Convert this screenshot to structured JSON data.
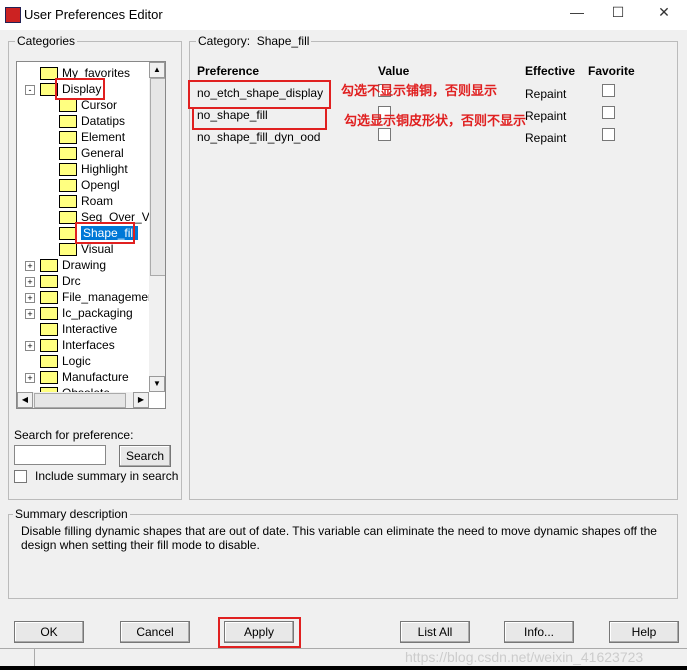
{
  "window": {
    "title": "User Preferences Editor",
    "min": "—",
    "max": "☐",
    "close": "✕"
  },
  "categories": {
    "label": "Categories",
    "items": [
      {
        "label": "My_favorites",
        "level": 0,
        "expander": ""
      },
      {
        "label": "Display",
        "level": 0,
        "expander": "-"
      },
      {
        "label": "Cursor",
        "level": 1,
        "expander": ""
      },
      {
        "label": "Datatips",
        "level": 1,
        "expander": ""
      },
      {
        "label": "Element",
        "level": 1,
        "expander": ""
      },
      {
        "label": "General",
        "level": 1,
        "expander": ""
      },
      {
        "label": "Highlight",
        "level": 1,
        "expander": ""
      },
      {
        "label": "Opengl",
        "level": 1,
        "expander": ""
      },
      {
        "label": "Roam",
        "level": 1,
        "expander": ""
      },
      {
        "label": "Seg_Over_Voi",
        "level": 1,
        "expander": ""
      },
      {
        "label": "Shape_fill",
        "level": 1,
        "expander": "",
        "selected": true
      },
      {
        "label": "Visual",
        "level": 1,
        "expander": ""
      },
      {
        "label": "Drawing",
        "level": 0,
        "expander": "+"
      },
      {
        "label": "Drc",
        "level": 0,
        "expander": "+"
      },
      {
        "label": "File_management",
        "level": 0,
        "expander": "+"
      },
      {
        "label": "Ic_packaging",
        "level": 0,
        "expander": "+"
      },
      {
        "label": "Interactive",
        "level": 0,
        "expander": ""
      },
      {
        "label": "Interfaces",
        "level": 0,
        "expander": "+"
      },
      {
        "label": "Logic",
        "level": 0,
        "expander": ""
      },
      {
        "label": "Manufacture",
        "level": 0,
        "expander": "+"
      },
      {
        "label": "Obsolete",
        "level": 0,
        "expander": ""
      }
    ]
  },
  "search": {
    "label": "Search for preference:",
    "value": "",
    "button": "Search",
    "include_summary": "Include summary in search",
    "include_checked": false
  },
  "category_panel": {
    "label": "Category:",
    "name": "Shape_fill",
    "headers": [
      "Preference",
      "Value",
      "Effective",
      "Favorite"
    ],
    "rows": [
      {
        "name": "no_etch_shape_display",
        "value": false,
        "effective": "Repaint",
        "favorite": false
      },
      {
        "name": "no_shape_fill",
        "value": false,
        "effective": "Repaint",
        "favorite": false
      },
      {
        "name": "no_shape_fill_dyn_ood",
        "value": false,
        "effective": "Repaint",
        "favorite": false
      }
    ]
  },
  "annotations": [
    "勾选不显示铺铜，否则显示",
    "勾选显示铜皮形状，否则不显示"
  ],
  "summary": {
    "label": "Summary description",
    "text": "Disable filling dynamic shapes that are out of date. This variable can eliminate the need to move dynamic shapes off the design when setting their fill mode to disable."
  },
  "buttons": {
    "ok": "OK",
    "cancel": "Cancel",
    "apply": "Apply",
    "list_all": "List All",
    "info": "Info...",
    "help": "Help"
  },
  "watermark": "https://blog.csdn.net/weixin_41623723",
  "highlight_color": "#e02020"
}
